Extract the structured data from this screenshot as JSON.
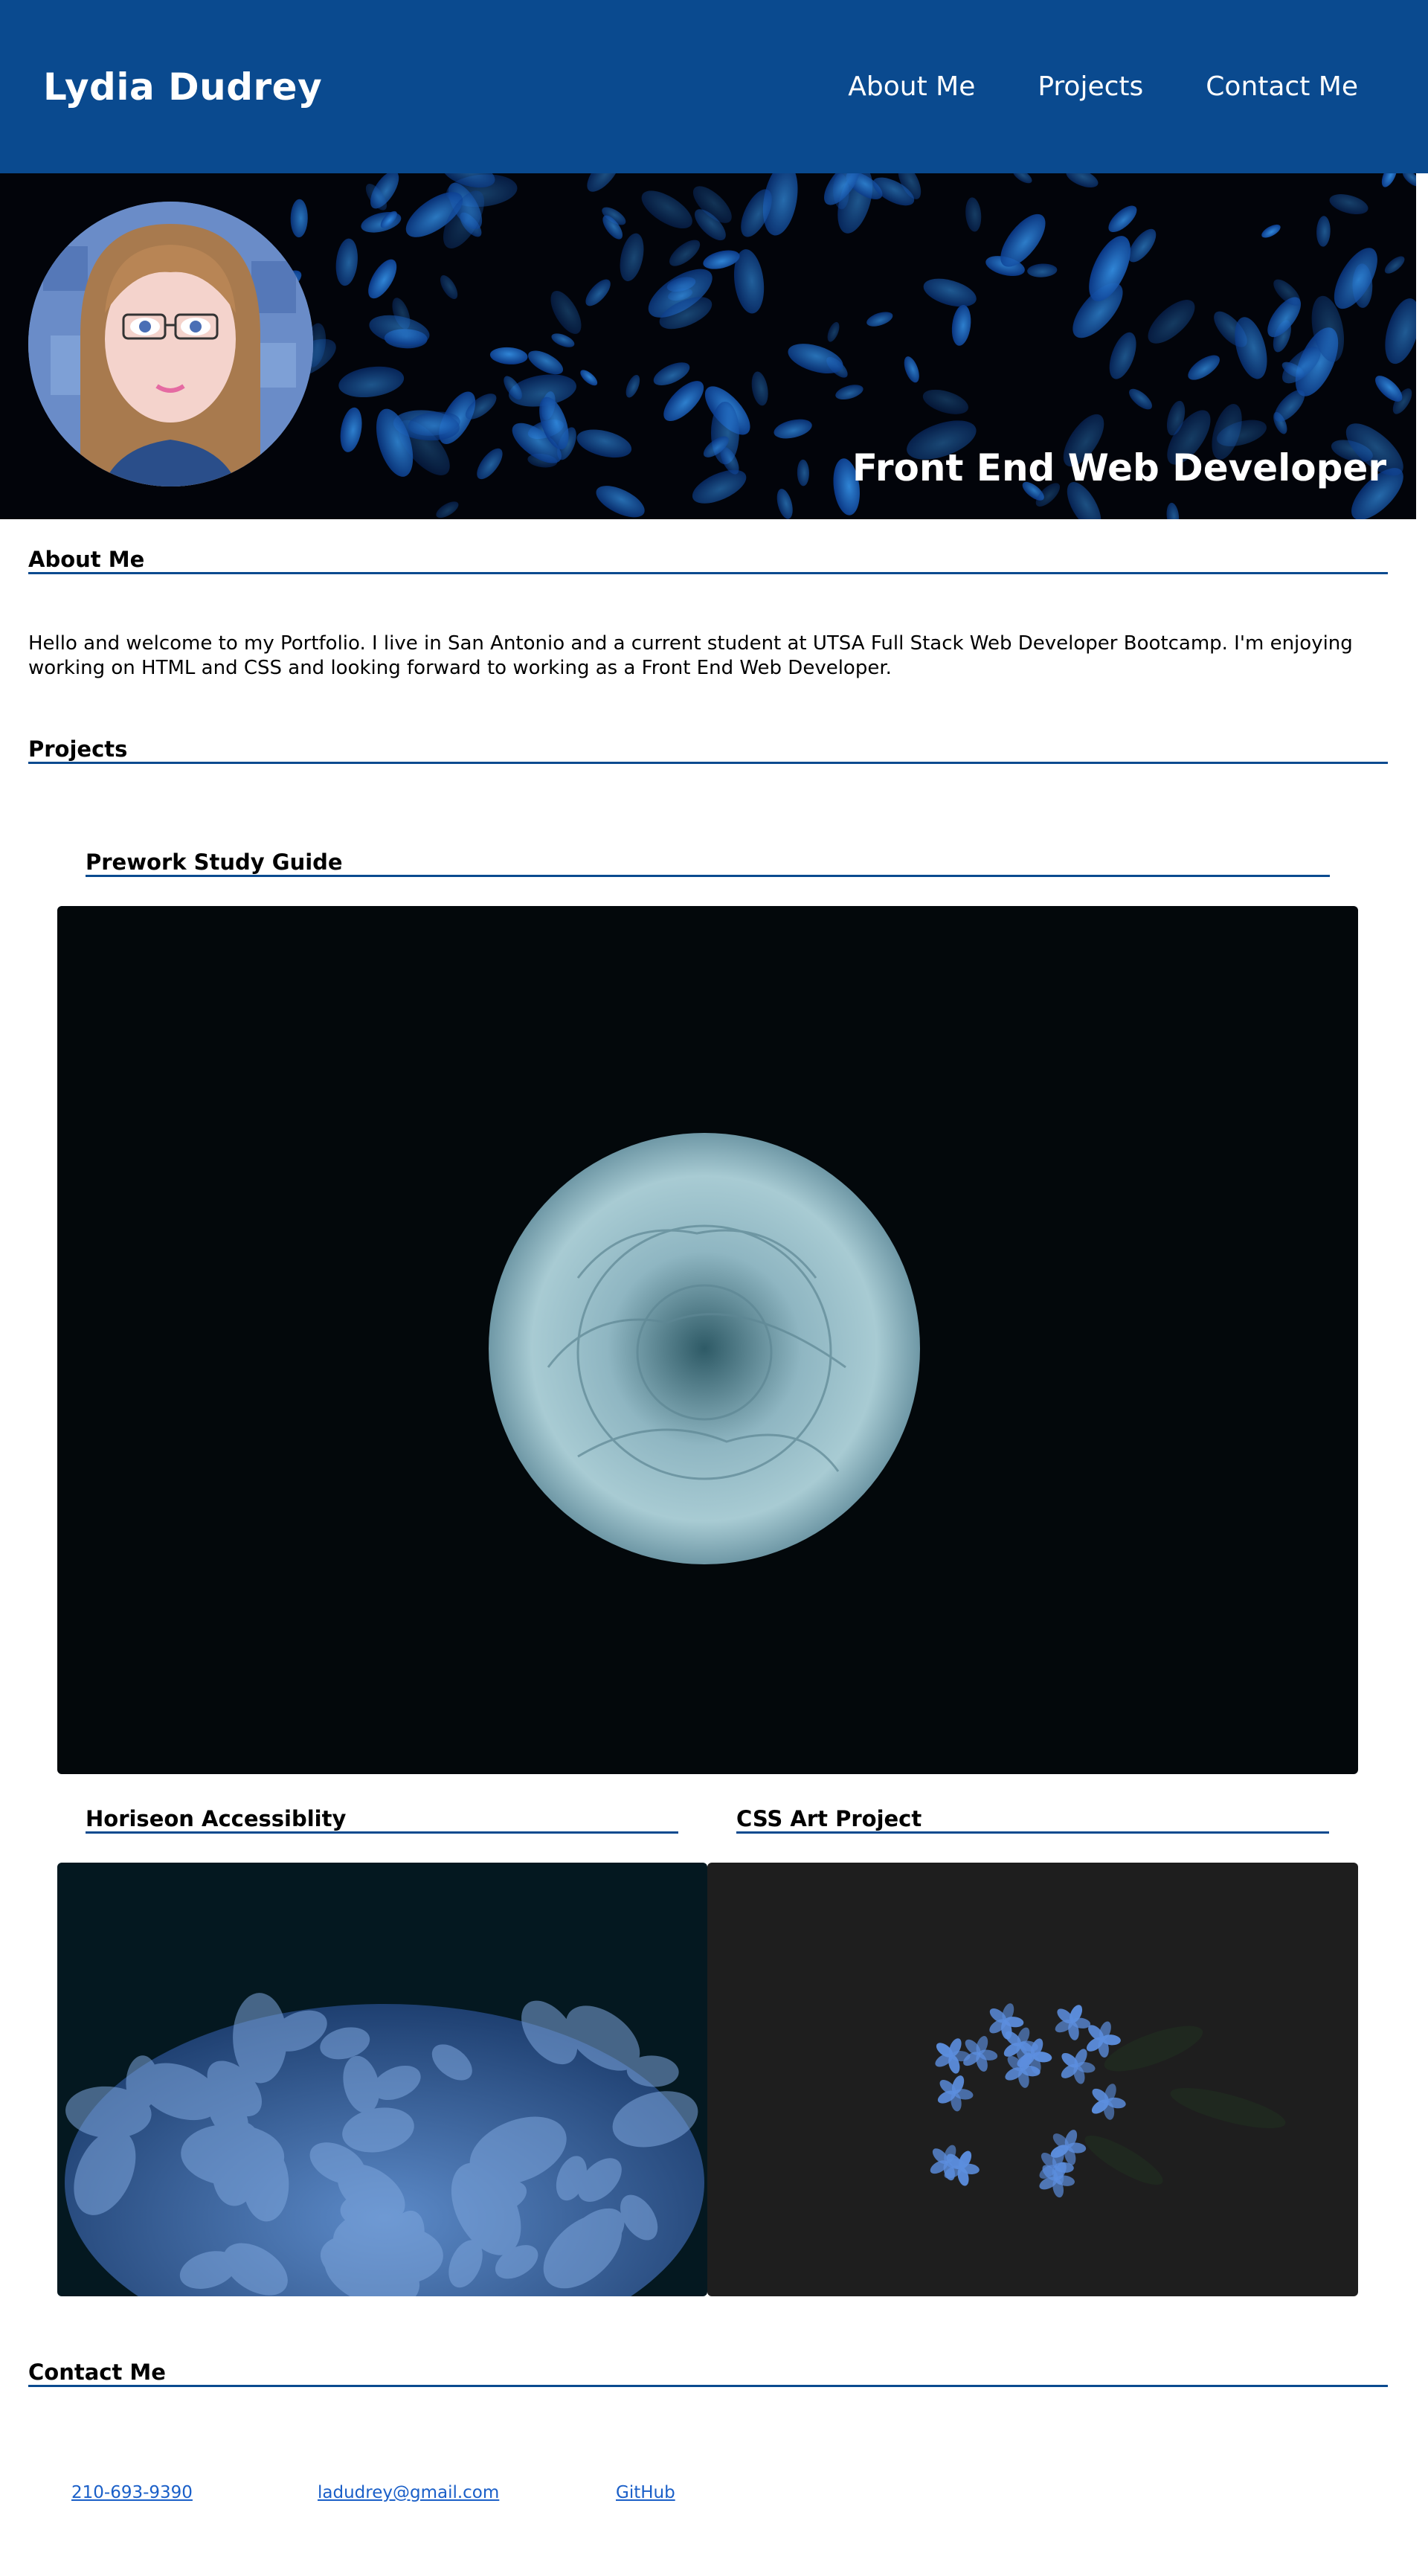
{
  "header": {
    "site_title": "Lydia Dudrey",
    "nav": [
      "About Me",
      "Projects",
      "Contact Me"
    ]
  },
  "hero": {
    "tagline": "Front End Web Developer"
  },
  "about": {
    "heading": "About Me",
    "text": "Hello and welcome to my Portfolio. I live in San Antonio and a current student at UTSA Full Stack Web Developer Bootcamp. I'm enjoying working on HTML and CSS and looking forward to working as a Front End Web Developer."
  },
  "projects": {
    "heading": "Projects",
    "items": [
      {
        "title": "Prework Study Guide"
      },
      {
        "title": "Horiseon Accessiblity"
      },
      {
        "title": "CSS Art Project"
      }
    ]
  },
  "contact": {
    "heading": "Contact Me",
    "phone": "210-693-9390",
    "email": "ladudrey@gmail.com",
    "github": "GitHub"
  },
  "colors": {
    "header_bg": "#0a4a8f",
    "accent_line": "#0a4a8f",
    "link": "#1a5fc8"
  }
}
